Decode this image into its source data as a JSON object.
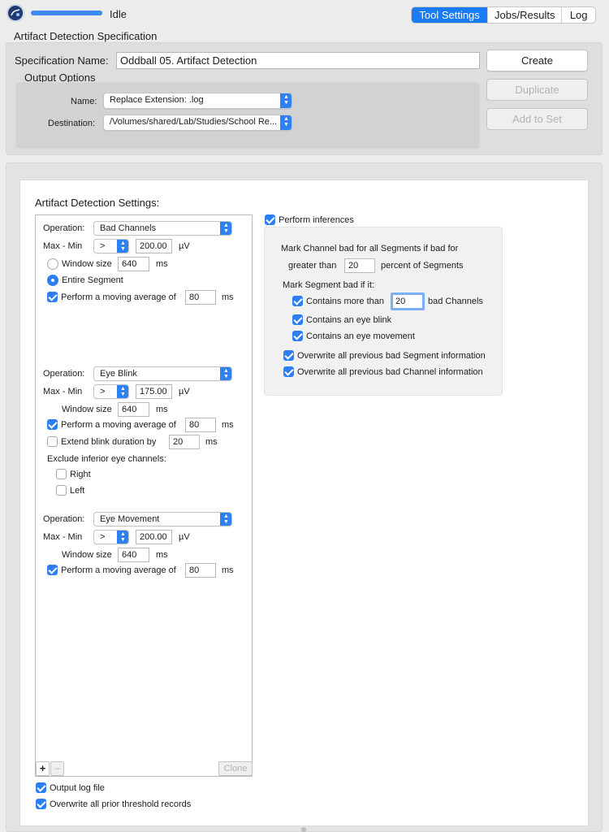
{
  "window": {
    "status": "Idle",
    "tabs": [
      "Tool Settings",
      "Jobs/Results",
      "Log"
    ],
    "active_tab": "Tool Settings",
    "accent": "#1a7cf4"
  },
  "spec": {
    "section_title": "Artifact Detection Specification",
    "name_label": "Specification Name:",
    "name_value": "Oddball 05. Artifact Detection",
    "output_options_title": "Output Options",
    "output_name_label": "Name:",
    "output_name_value": "Replace Extension: .log",
    "destination_label": "Destination:",
    "destination_value": "/Volumes/shared/Lab/Studies/School Re...",
    "buttons": {
      "create": "Create",
      "duplicate": "Duplicate",
      "add_to_set": "Add to Set"
    }
  },
  "settings": {
    "title": "Artifact Detection Settings:",
    "operation_label": "Operation:",
    "maxmin_label": "Max - Min",
    "unit_uv": "µV",
    "unit_ms": "ms",
    "window_size_label": "Window size",
    "moving_avg_label": "Perform a moving average of",
    "bad_channels": {
      "operation": "Bad Channels",
      "comparator": ">",
      "threshold": "200.00",
      "window_size": "640",
      "entire_segment_label": "Entire Segment",
      "window_mode": "entire-segment",
      "moving_avg_checked": true,
      "moving_avg_value": "80"
    },
    "eye_blink": {
      "operation": "Eye Blink",
      "comparator": ">",
      "threshold": "175.00",
      "window_size": "640",
      "moving_avg_checked": true,
      "moving_avg_value": "80",
      "extend_label": "Extend blink duration by",
      "extend_checked": false,
      "extend_value": "20",
      "exclude_label": "Exclude inferior eye channels:",
      "right_label": "Right",
      "left_label": "Left"
    },
    "eye_movement": {
      "operation": "Eye Movement",
      "comparator": ">",
      "threshold": "200.00",
      "window_size": "640",
      "moving_avg_checked": true,
      "moving_avg_value": "80"
    },
    "list_buttons": {
      "add": "+",
      "remove": "−",
      "clone": "Clone"
    },
    "output_log_label": "Output log file",
    "overwrite_prior_label": "Overwrite all prior threshold records"
  },
  "inferences": {
    "perform_label": "Perform inferences",
    "channel_bad_line1": "Mark Channel bad for all Segments if bad for",
    "greater_than_label": "greater than",
    "greater_than_value": "20",
    "percent_label": "percent of Segments",
    "segment_bad_label": "Mark Segment bad if it:",
    "contains_more_label": "Contains more than",
    "contains_more_value": "20",
    "bad_channels_label": "bad Channels",
    "eye_blink_label": "Contains an eye blink",
    "eye_movement_label": "Contains an eye movement",
    "overwrite_segment_label": "Overwrite all previous bad Segment information",
    "overwrite_channel_label": "Overwrite all previous bad Channel information"
  }
}
